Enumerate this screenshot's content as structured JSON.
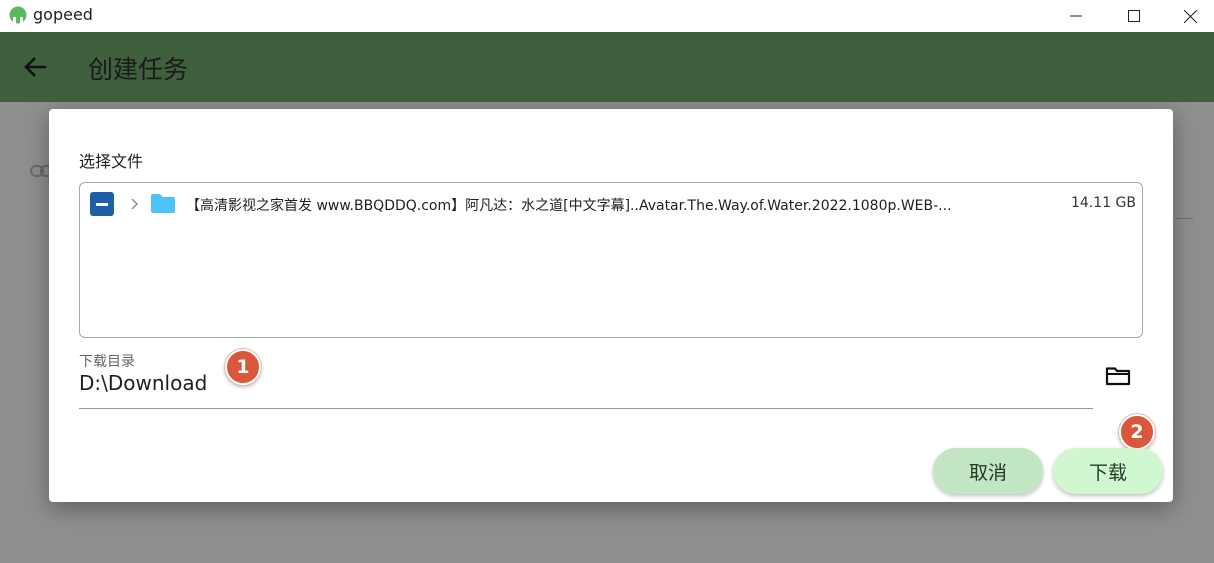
{
  "window": {
    "app_name": "gopeed"
  },
  "appbar": {
    "title": "创建任务"
  },
  "dialog": {
    "select_files_label": "选择文件",
    "files": [
      {
        "name": "【高清影视之家首发 www.BBQDDQ.com】阿凡达：水之道[中文字幕]..Avatar.The.Way.of.Water.2022.1080p.WEB-...",
        "size": "14.11 GB",
        "type_icon": "folder-icon",
        "checkbox_state": "partial"
      }
    ],
    "download_dir": {
      "label": "下载目录",
      "value": "D:\\Download"
    },
    "buttons": {
      "cancel": "取消",
      "download": "下载"
    },
    "annotations": {
      "badge_1": "1",
      "badge_2": "2"
    }
  },
  "colors": {
    "appbar": "#3f603d",
    "badge": "#d9583b",
    "checkbox": "#1f5fa8",
    "folder": "#4fc3f7",
    "cancel_button": "#c2e5c4",
    "download_button": "#d1f7d1"
  }
}
